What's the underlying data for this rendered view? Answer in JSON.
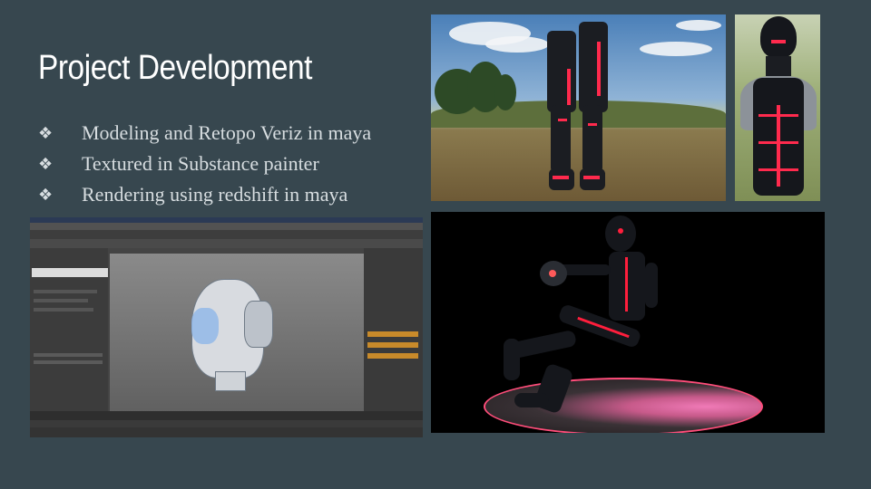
{
  "slide": {
    "title": "Project Development",
    "bullet_glyph": "❖",
    "bullets": [
      "Modeling and Retopo Veriz in maya",
      "Textured in Substance painter",
      "Rendering using redshift in maya"
    ]
  },
  "colors": {
    "background": "#37474f",
    "title": "#ffffff",
    "bullet_text": "#d7dde0",
    "accent_glow": "#ff1e3c"
  },
  "images": {
    "legs": "render-legs-outdoor",
    "bust": "render-bust-outdoor",
    "maya": "maya-screenshot-head-model",
    "full": "render-full-body-pink-platform"
  }
}
